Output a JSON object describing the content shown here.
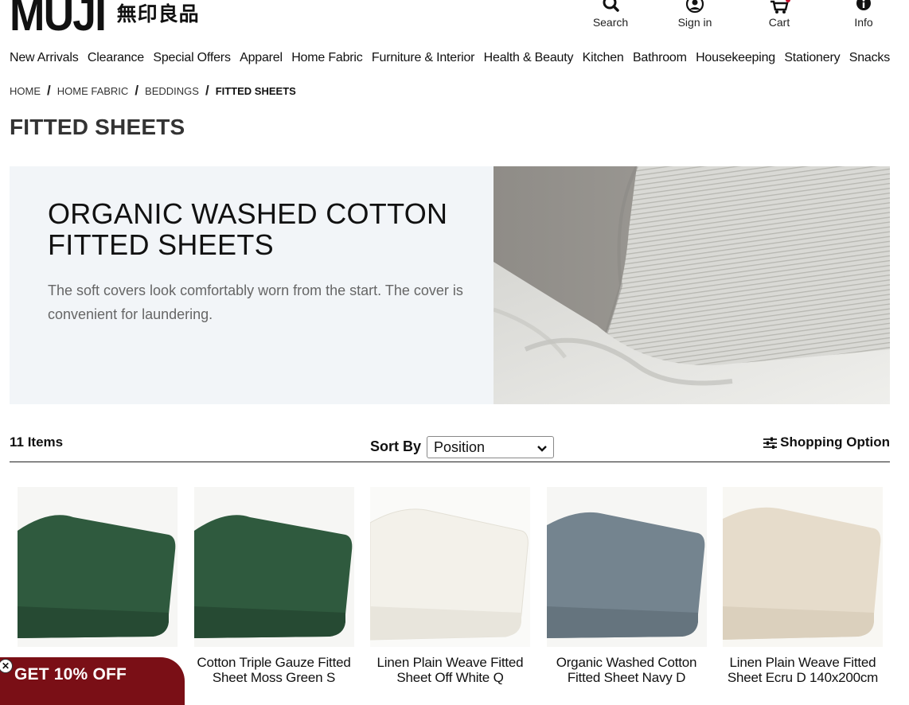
{
  "brand": {
    "name_en": "MUJI",
    "name_jp": "無印良品"
  },
  "utility": [
    {
      "label": "Search",
      "icon": "search-icon"
    },
    {
      "label": "Sign in",
      "icon": "user-icon"
    },
    {
      "label": "Cart",
      "icon": "cart-icon"
    },
    {
      "label": "Info",
      "icon": "info-icon"
    }
  ],
  "nav": [
    "New Arrivals",
    "Clearance",
    "Special Offers",
    "Apparel",
    "Home Fabric",
    "Furniture & Interior",
    "Health & Beauty",
    "Kitchen",
    "Bathroom",
    "Housekeeping",
    "Stationery",
    "Snacks"
  ],
  "breadcrumb": [
    "HOME",
    "HOME FABRIC",
    "BEDDINGS",
    "FITTED SHEETS"
  ],
  "page_title": "FITTED SHEETS",
  "banner": {
    "title_line1": "ORGANIC WASHED COTTON",
    "title_line2": "FITTED SHEETS",
    "description": "The soft covers look comfortably worn from the start. The cover is convenient for laundering."
  },
  "toolbar": {
    "items_count": "11 Items",
    "sort_label": "Sort By",
    "sort_value": "Position",
    "shopping_option": "Shopping Option"
  },
  "products": [
    {
      "name_line1": "",
      "name_line2": "",
      "color": "#2f5a3e"
    },
    {
      "name_line1": "Cotton Triple Gauze Fitted",
      "name_line2": "Sheet Moss Green S",
      "color": "#2f5a3e"
    },
    {
      "name_line1": "Linen Plain Weave Fitted",
      "name_line2": "Sheet Off White Q",
      "color": "#f3f1ea"
    },
    {
      "name_line1": "Organic Washed Cotton",
      "name_line2": "Fitted Sheet Navy D",
      "color": "#74848f"
    },
    {
      "name_line1": "Linen Plain Weave Fitted",
      "name_line2": "Sheet Ecru D 140x200cm",
      "color": "#e6dccb"
    }
  ],
  "promo": {
    "text": "GET 10% OFF",
    "color": "#7a0f16"
  }
}
